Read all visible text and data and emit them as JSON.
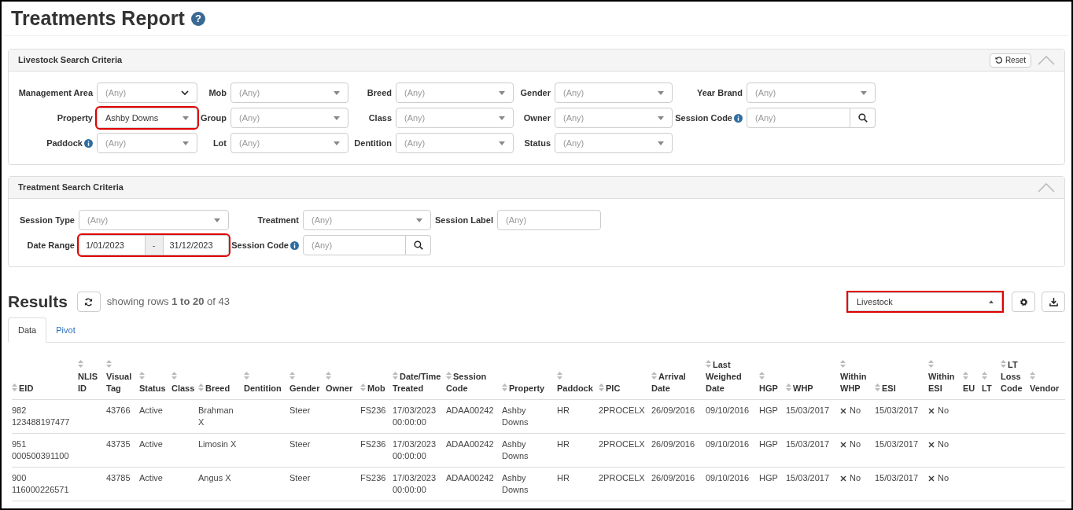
{
  "title": "Treatments Report",
  "help": "?",
  "livestock": {
    "title": "Livestock Search Criteria",
    "reset": "Reset",
    "expanded": true,
    "fields": [
      {
        "label": "Management Area",
        "kind": "native",
        "placeholder": "(Any)"
      },
      {
        "label": "Mob",
        "kind": "select",
        "placeholder": "(Any)"
      },
      {
        "label": "Breed",
        "kind": "select",
        "placeholder": "(Any)"
      },
      {
        "label": "Gender",
        "kind": "select",
        "placeholder": "(Any)"
      },
      {
        "label": "Year Brand",
        "kind": "select",
        "placeholder": "(Any)"
      },
      {
        "label": "Property",
        "kind": "select",
        "value": "Ashby Downs",
        "highlighted": true
      },
      {
        "label": "Group",
        "kind": "select",
        "placeholder": "(Any)"
      },
      {
        "label": "Class",
        "kind": "select",
        "placeholder": "(Any)"
      },
      {
        "label": "Owner",
        "kind": "select",
        "placeholder": "(Any)"
      },
      {
        "label": "Session Code",
        "kind": "search",
        "placeholder": "(Any)",
        "info": true
      },
      {
        "label": "Paddock",
        "kind": "select",
        "placeholder": "(Any)",
        "info": true
      },
      {
        "label": "Lot",
        "kind": "select",
        "placeholder": "(Any)"
      },
      {
        "label": "Dentition",
        "kind": "select",
        "placeholder": "(Any)"
      },
      {
        "label": "Status",
        "kind": "select",
        "placeholder": "(Any)"
      }
    ]
  },
  "treatment": {
    "title": "Treatment Search Criteria",
    "expanded": true,
    "fields": [
      {
        "label": "Session Type",
        "kind": "select",
        "placeholder": "(Any)"
      },
      {
        "label": "Treatment",
        "kind": "select",
        "placeholder": "(Any)"
      },
      {
        "label": "Session Label",
        "kind": "text",
        "placeholder": "(Any)"
      },
      {
        "label": "Date Range",
        "kind": "daterange",
        "from": "1/01/2023",
        "separator": "-",
        "to": "31/12/2023",
        "highlighted": true
      },
      {
        "label": "Session Code",
        "kind": "search",
        "placeholder": "(Any)",
        "info": true
      }
    ]
  },
  "results": {
    "title": "Results",
    "summary": "showing rows **1 to 20** of 43",
    "view": "Livestock",
    "view_highlighted": true,
    "tabs": [
      {
        "label": "Data",
        "selected": true
      },
      {
        "label": "Pivot",
        "selected": false
      }
    ],
    "columns": [
      "EID",
      "NLIS ID",
      "Visual Tag",
      "Status",
      "Class",
      "Breed",
      "Dentition",
      "Gender",
      "Owner",
      "Mob",
      "Date/Time Treated",
      "Session Code",
      "Property",
      "Paddock",
      "PIC",
      "Arrival Date",
      "Last Weighed Date",
      "HGP",
      "WHP",
      "Within WHP",
      "ESI",
      "Within ESI",
      "EU",
      "LT",
      "LT Loss Code",
      "Vendor"
    ],
    "rows": [
      [
        "982 123488197477",
        "",
        "43766",
        "Active",
        "",
        "Brahman X",
        "",
        "Steer",
        "",
        "FS236",
        "17/03/2023 00:00:00",
        "ADAA00242",
        "Ashby Downs",
        "HR",
        "2PROCELX",
        "26/09/2016",
        "09/10/2016",
        "HGP",
        "15/03/2017",
        "No",
        "15/03/2017",
        "No",
        "",
        "",
        "",
        ""
      ],
      [
        "951 000500391100",
        "",
        "43735",
        "Active",
        "",
        "Limosin X",
        "",
        "Steer",
        "",
        "FS236",
        "17/03/2023 00:00:00",
        "ADAA00242",
        "Ashby Downs",
        "HR",
        "2PROCELX",
        "26/09/2016",
        "09/10/2016",
        "HGP",
        "15/03/2017",
        "No",
        "15/03/2017",
        "No",
        "",
        "",
        "",
        ""
      ],
      [
        "900 116000226571",
        "",
        "43785",
        "Active",
        "",
        "Angus X",
        "",
        "Steer",
        "",
        "FS236",
        "17/03/2023 00:00:00",
        "ADAA00242",
        "Ashby Downs",
        "HR",
        "2PROCELX",
        "26/09/2016",
        "09/10/2016",
        "HGP",
        "15/03/2017",
        "No",
        "15/03/2017",
        "No",
        "",
        "",
        "",
        ""
      ]
    ]
  }
}
